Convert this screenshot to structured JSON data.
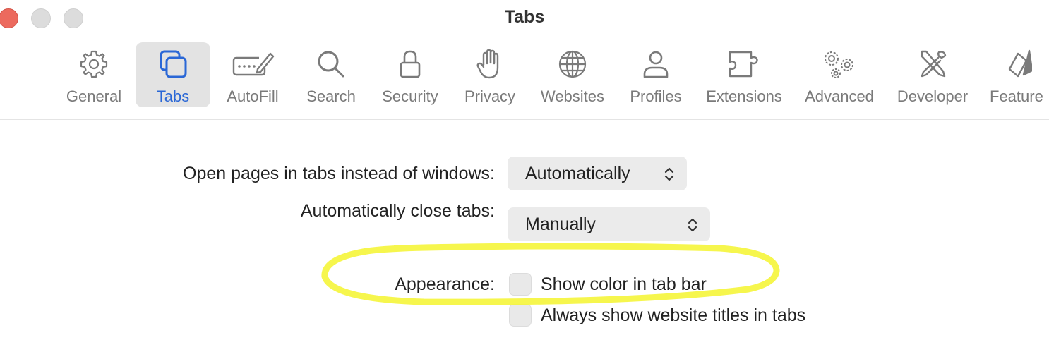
{
  "window": {
    "title": "Tabs",
    "traffic_lights": [
      "close",
      "minimize",
      "zoom"
    ],
    "colors": {
      "close": "#ec6a5e",
      "inactive": "#dcdcdc"
    }
  },
  "toolbar": {
    "selected": "Tabs",
    "accent_color": "#2a67d6",
    "items": [
      {
        "label": "General",
        "icon": "gear-icon"
      },
      {
        "label": "Tabs",
        "icon": "tabs-icon"
      },
      {
        "label": "AutoFill",
        "icon": "autofill-icon"
      },
      {
        "label": "Search",
        "icon": "magnifier-icon"
      },
      {
        "label": "Security",
        "icon": "lock-icon"
      },
      {
        "label": "Privacy",
        "icon": "hand-icon"
      },
      {
        "label": "Websites",
        "icon": "globe-icon"
      },
      {
        "label": "Profiles",
        "icon": "person-icon"
      },
      {
        "label": "Extensions",
        "icon": "puzzle-icon"
      },
      {
        "label": "Advanced",
        "icon": "gears-icon"
      },
      {
        "label": "Developer",
        "icon": "tools-icon"
      },
      {
        "label": "Feature",
        "icon": "flags-icon"
      }
    ]
  },
  "settings": {
    "open_pages": {
      "label": "Open pages in tabs instead of windows:",
      "value": "Automatically"
    },
    "auto_close": {
      "label": "Automatically close tabs:",
      "value": "Manually"
    },
    "appearance": {
      "label": "Appearance:",
      "options": [
        {
          "label": "Show color in tab bar",
          "checked": false
        },
        {
          "label": "Always show website titles in tabs",
          "checked": false
        }
      ]
    }
  },
  "annotation": {
    "shape": "freehand-ellipse",
    "color": "#f5f53a"
  }
}
